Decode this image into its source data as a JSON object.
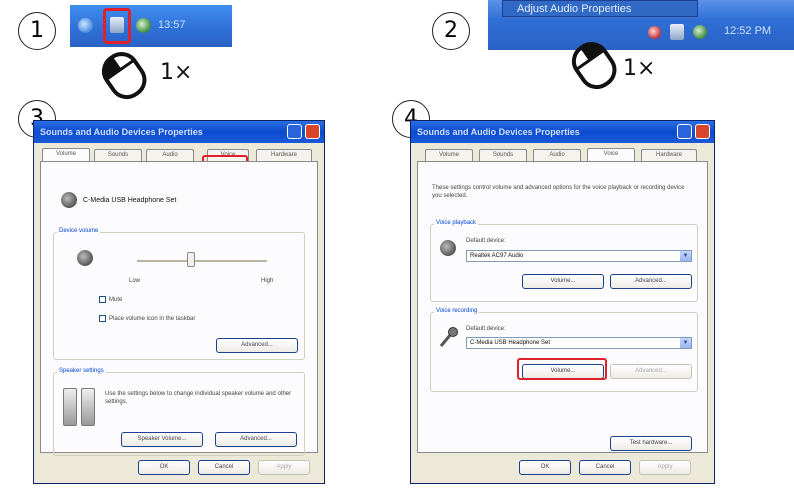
{
  "steps": [
    {
      "number": "1",
      "multiplier": "1×",
      "clock": "13:57"
    },
    {
      "number": "2",
      "multiplier": "1×",
      "menu_item": "Adjust Audio Properties",
      "clock": "12:52 PM"
    },
    {
      "number": "3"
    },
    {
      "number": "4"
    }
  ],
  "dialog3": {
    "title": "Sounds and Audio Devices Properties",
    "tabs": [
      "Volume",
      "Sounds",
      "Audio",
      "Voice",
      "Hardware"
    ],
    "active_tab": "Volume",
    "highlighted_tab": "Voice",
    "device_name": "C-Media USB Headphone Set",
    "device_volume_label": "Device volume",
    "low_label": "Low",
    "high_label": "High",
    "mute_label": "Mute",
    "place_icon_label": "Place volume icon in the taskbar",
    "advanced_label": "Advanced...",
    "speaker_settings_label": "Speaker settings",
    "speaker_text": "Use the settings below to change individual speaker volume and other settings.",
    "speaker_volume_button": "Speaker Volume...",
    "speaker_advanced_button": "Advanced...",
    "ok": "OK",
    "cancel": "Cancel",
    "apply": "Apply"
  },
  "dialog4": {
    "title": "Sounds and Audio Devices Properties",
    "tabs": [
      "Volume",
      "Sounds",
      "Audio",
      "Voice",
      "Hardware"
    ],
    "active_tab": "Voice",
    "intro_text": "These settings control volume and advanced options for the voice playback or recording device you selected.",
    "voice_playback_label": "Voice playback",
    "playback_default_label": "Default device:",
    "playback_device": "Realtek AC97 Audio",
    "playback_volume_button": "Volume...",
    "playback_advanced_button": "Advanced...",
    "voice_recording_label": "Voice recording",
    "recording_default_label": "Default device:",
    "recording_device": "C-Media USB Headphone Set",
    "recording_volume_button": "Volume...",
    "recording_advanced_button": "Advanced...",
    "test_hardware_button": "Test hardware...",
    "ok": "OK",
    "cancel": "Cancel",
    "apply": "Apply"
  },
  "colors": {
    "highlight": "#e0202a",
    "taskbar": "#2f6fd6",
    "dialog_bg": "#ece9d8",
    "titlebar": "#0b4bd0"
  },
  "icons": [
    "mouse-icon",
    "speaker-tray-icon",
    "network-tray-icon",
    "microphone-icon",
    "speaker-icon"
  ]
}
